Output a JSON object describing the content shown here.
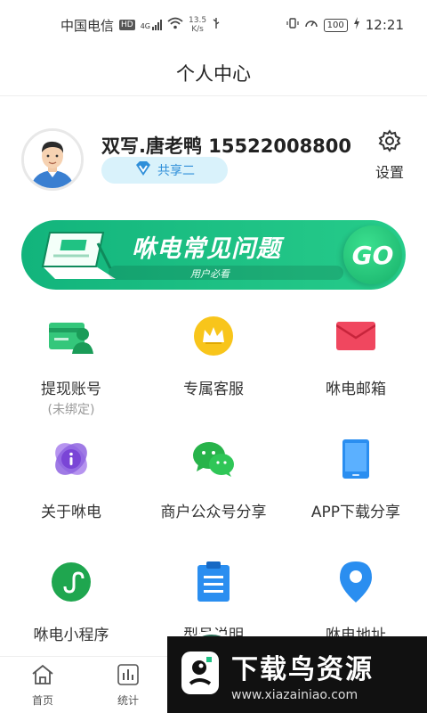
{
  "status_bar": {
    "carrier": "中国电信",
    "hd": "HD",
    "network": "4G",
    "speed_value": "13.5",
    "speed_unit": "K/s",
    "battery": "100",
    "time": "12:21"
  },
  "header": {
    "title": "个人中心"
  },
  "profile": {
    "name": "双写.唐老鸭 15522008800",
    "badge_label": "共享二",
    "settings_label": "设置"
  },
  "banner": {
    "title": "咻电常见问题",
    "subtitle": "用户必看",
    "go_label": "GO"
  },
  "grid": {
    "items": [
      {
        "label": "提现账号",
        "sub": "(未绑定)"
      },
      {
        "label": "专属客服"
      },
      {
        "label": "咻电邮箱"
      },
      {
        "label": "关于咻电"
      },
      {
        "label": "商户公众号分享"
      },
      {
        "label": "APP下载分享"
      },
      {
        "label": "咻电小程序"
      },
      {
        "label": "型号说明"
      },
      {
        "label": "咻电地址"
      }
    ]
  },
  "bottom_nav": {
    "items": [
      {
        "label": "首页"
      },
      {
        "label": "统计"
      }
    ]
  },
  "watermark": {
    "title": "下载鸟资源",
    "url": "www.xiazainiao.com"
  },
  "colors": {
    "accent_green": "#1fc285",
    "badge_blue": "#2f8fd9",
    "badge_bg": "#d9f2fb"
  }
}
